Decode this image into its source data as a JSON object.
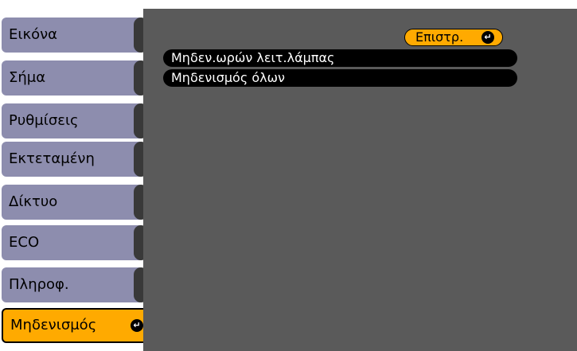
{
  "sidebar": {
    "items": [
      {
        "label": "Εικόνα"
      },
      {
        "label": "Σήμα"
      },
      {
        "label": "Ρυθμίσεις"
      },
      {
        "label": "Εκτεταμένη"
      },
      {
        "label": "Δίκτυο"
      },
      {
        "label": "ECO"
      },
      {
        "label": "Πληροφ."
      },
      {
        "label": "Μηδενισμός",
        "selected": true
      }
    ]
  },
  "panel": {
    "return_label": "Επιστρ.",
    "options": [
      {
        "label": "Μηδεν.ωρών λειτ.λάμπας"
      },
      {
        "label": "Μηδενισμός όλων"
      }
    ]
  },
  "colors": {
    "accent": "#ffaa00",
    "tab": "#8d8dae",
    "panel": "#5a5a5a"
  },
  "icons": {
    "enter": "enter-return-icon"
  }
}
